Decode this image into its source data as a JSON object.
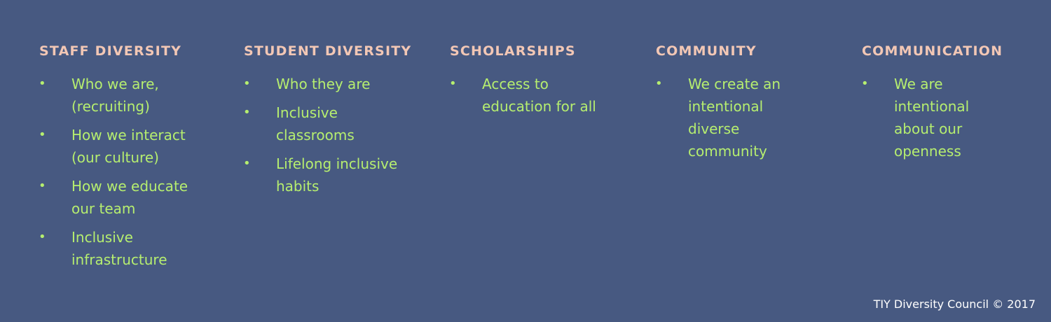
{
  "columns": [
    {
      "title": "STAFF DIVERSITY",
      "items": [
        "Who we are, (recruiting)",
        "How we interact (our culture)",
        "How we educate our team",
        "Inclusive infrastructure"
      ]
    },
    {
      "title": "STUDENT DIVERSITY",
      "items": [
        "Who they are",
        "Inclusive classrooms",
        "Lifelong inclusive habits"
      ]
    },
    {
      "title": "SCHOLARSHIPS",
      "items": [
        "Access to education for all"
      ]
    },
    {
      "title": "COMMUNITY",
      "items": [
        "We create an intentional diverse community"
      ]
    },
    {
      "title": "COMMUNICATION",
      "items": [
        "We are intentional about our openness"
      ]
    }
  ],
  "bullet": "•",
  "footer": "TIY Diversity Council © 2017",
  "colors": {
    "background": "#475981",
    "heading": "#f2c7b5",
    "item_text": "#b6ee6f",
    "footer_text": "#ffffff"
  }
}
